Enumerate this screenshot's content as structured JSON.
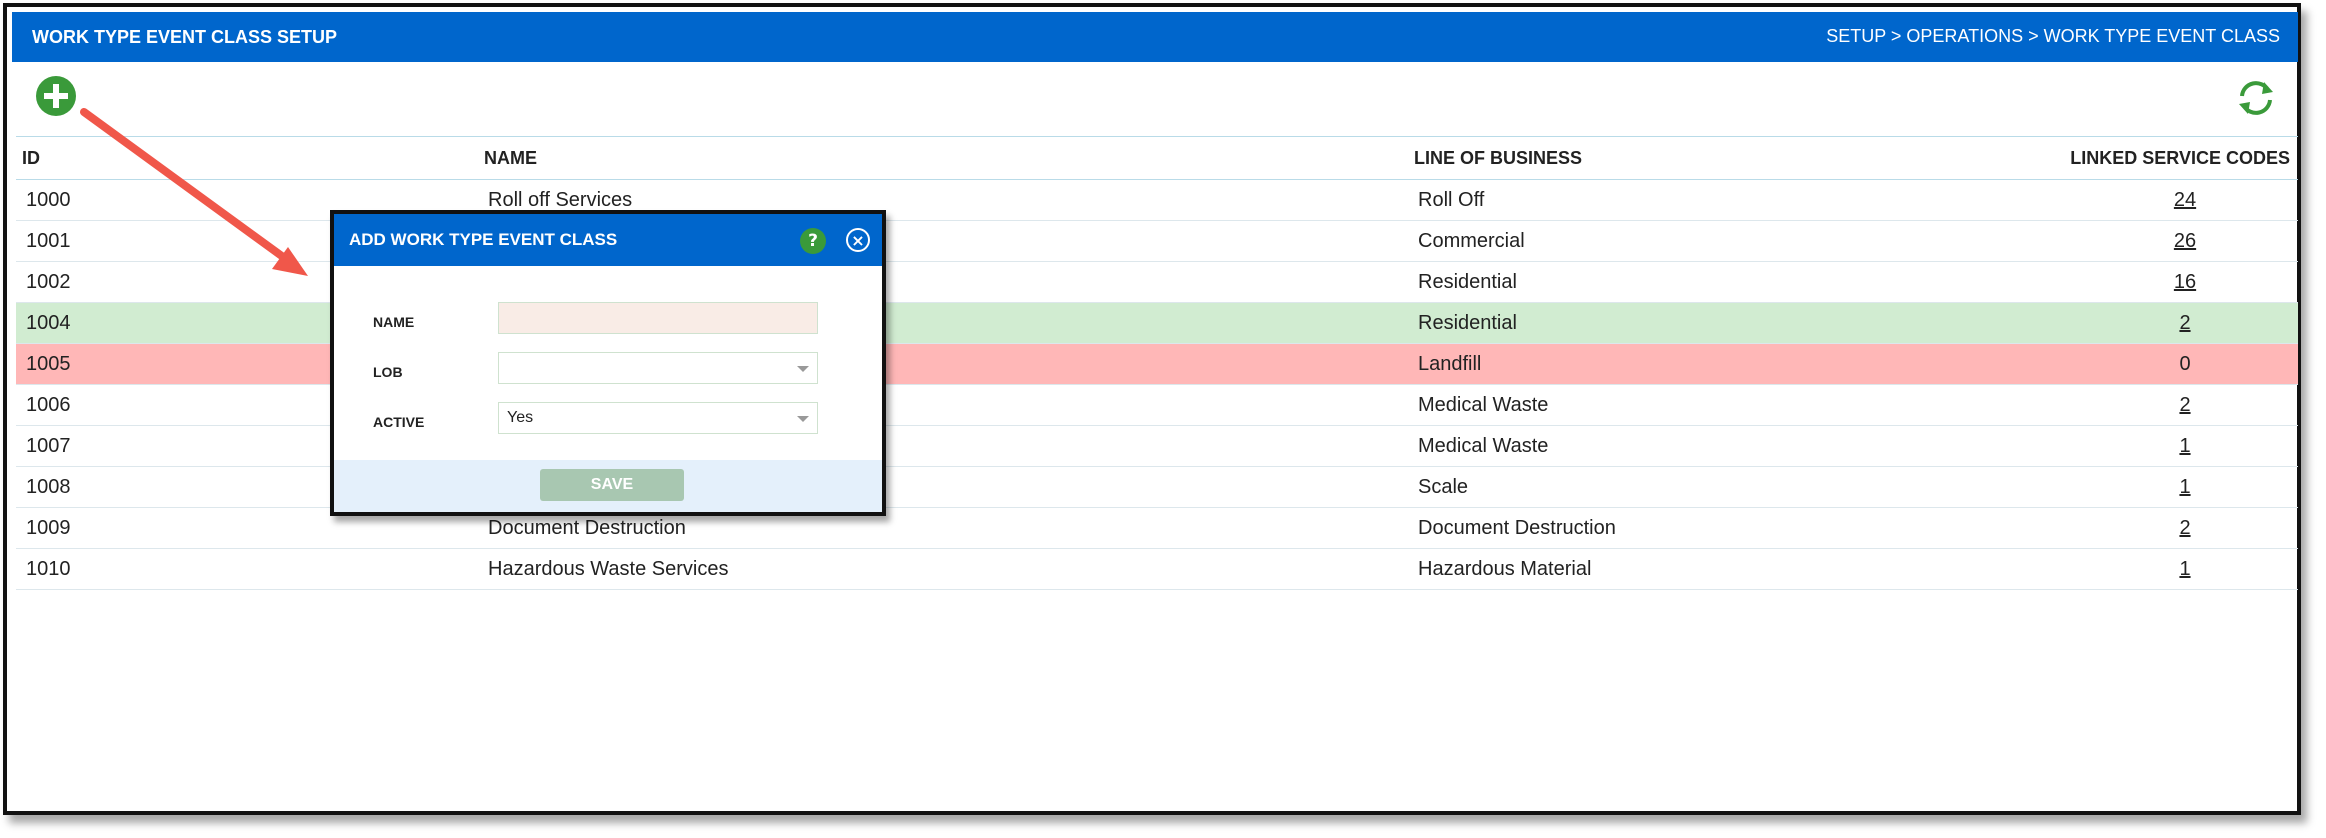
{
  "header": {
    "title": "WORK TYPE EVENT CLASS SETUP",
    "breadcrumb": "SETUP > OPERATIONS > WORK TYPE EVENT CLASS"
  },
  "colors": {
    "header_blue": "#0066cc",
    "add_green": "#3a9a3a",
    "row_green": "#d1ecd1",
    "row_red": "#ffb7b7",
    "annotation_arrow": "#f0574a"
  },
  "icons": {
    "add": "plus-circle-icon",
    "refresh": "refresh-icon",
    "help": "question-icon",
    "close": "close-icon"
  },
  "table": {
    "columns": [
      "ID",
      "NAME",
      "LINE OF BUSINESS",
      "LINKED SERVICE CODES"
    ],
    "rows": [
      {
        "id": "1000",
        "name": "Roll off Services",
        "lob": "Roll Off",
        "codes": "24",
        "status": ""
      },
      {
        "id": "1001",
        "name": "",
        "lob": "Commercial",
        "codes": "26",
        "status": ""
      },
      {
        "id": "1002",
        "name": "",
        "lob": "Residential",
        "codes": "16",
        "status": ""
      },
      {
        "id": "1004",
        "name": "",
        "lob": "Residential",
        "codes": "2",
        "status": "green"
      },
      {
        "id": "1005",
        "name": "",
        "lob": "Landfill",
        "codes": "0",
        "status": "red"
      },
      {
        "id": "1006",
        "name": "",
        "lob": "Medical Waste",
        "codes": "2",
        "status": ""
      },
      {
        "id": "1007",
        "name": "",
        "lob": "Medical Waste",
        "codes": "1",
        "status": ""
      },
      {
        "id": "1008",
        "name": "",
        "lob": "Scale",
        "codes": "1",
        "status": ""
      },
      {
        "id": "1009",
        "name": "Document Destruction",
        "lob": "Document Destruction",
        "codes": "2",
        "status": ""
      },
      {
        "id": "1010",
        "name": "Hazardous Waste Services",
        "lob": "Hazardous Material",
        "codes": "1",
        "status": ""
      }
    ]
  },
  "modal": {
    "title": "ADD WORK TYPE EVENT CLASS",
    "help": "?",
    "close": "×",
    "name_label": "NAME",
    "name_value": "",
    "lob_label": "LOB",
    "lob_value": "",
    "active_label": "ACTIVE",
    "active_value": "Yes",
    "save_label": "SAVE"
  }
}
